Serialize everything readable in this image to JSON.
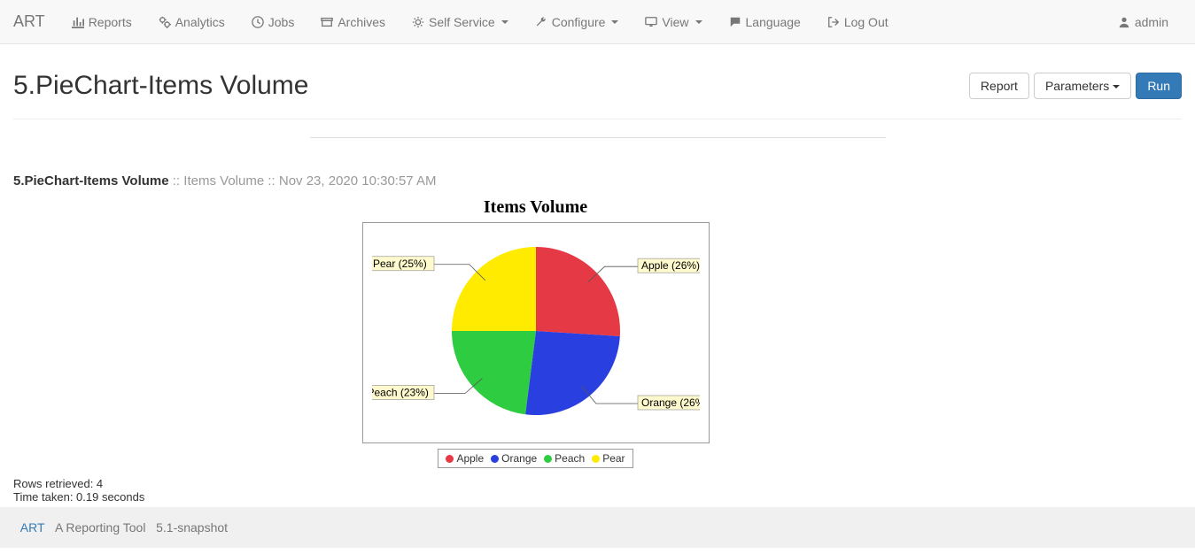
{
  "brand": "ART",
  "nav": {
    "reports": "Reports",
    "analytics": "Analytics",
    "jobs": "Jobs",
    "archives": "Archives",
    "self_service": "Self Service",
    "configure": "Configure",
    "view": "View",
    "language": "Language",
    "logout": "Log Out"
  },
  "user": "admin",
  "page_title": "5.PieChart-Items Volume",
  "buttons": {
    "report": "Report",
    "parameters": "Parameters",
    "run": "Run"
  },
  "report_header": {
    "name": "5.PieChart-Items Volume",
    "desc": "Items Volume",
    "timestamp": "Nov 23, 2020 10:30:57 AM"
  },
  "chart_data": {
    "type": "pie",
    "title": "Items Volume",
    "series": [
      {
        "name": "Apple",
        "pct": 26,
        "color": "#e63946"
      },
      {
        "name": "Orange",
        "pct": 26,
        "color": "#2a3fe0"
      },
      {
        "name": "Peach",
        "pct": 23,
        "color": "#2ecc40"
      },
      {
        "name": "Pear",
        "pct": 25,
        "color": "#ffeb00"
      }
    ],
    "legend": [
      "Apple",
      "Orange",
      "Peach",
      "Pear"
    ]
  },
  "stats": {
    "rows": "Rows retrieved: 4",
    "time": "Time taken: 0.19 seconds"
  },
  "footer": {
    "link": "ART",
    "desc": "A Reporting Tool",
    "version": "5.1-snapshot"
  }
}
